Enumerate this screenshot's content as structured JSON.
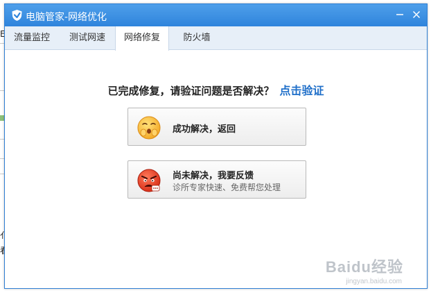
{
  "window": {
    "title": "电脑管家-网络优化",
    "minimize_icon": "minimize-icon",
    "close_icon": "close-icon"
  },
  "tabs": [
    {
      "label": "流量监控",
      "active": false
    },
    {
      "label": "测试网速",
      "active": false
    },
    {
      "label": "网络修复",
      "active": true
    },
    {
      "label": "防火墙",
      "active": false
    }
  ],
  "main": {
    "question": "已完成修复，请验证问题是否解决？",
    "verify_link": "点击验证",
    "option_resolved": {
      "title": "成功解决，返回",
      "icon": "happy-face-icon"
    },
    "option_unresolved": {
      "title": "尚未解决，我要反馈",
      "subtitle": "诊所专家快速、免费帮您处理",
      "icon": "angry-face-icon"
    }
  },
  "watermark": {
    "brand": "Baidu经验",
    "url": "jingyan.baidu.com"
  },
  "background_fragments": {
    "chars": [
      "E",
      "亻",
      "看"
    ]
  },
  "colors": {
    "titlebar": "#3a8ee3",
    "link": "#1f6fc9",
    "tab_bar": "#e7eff8"
  }
}
